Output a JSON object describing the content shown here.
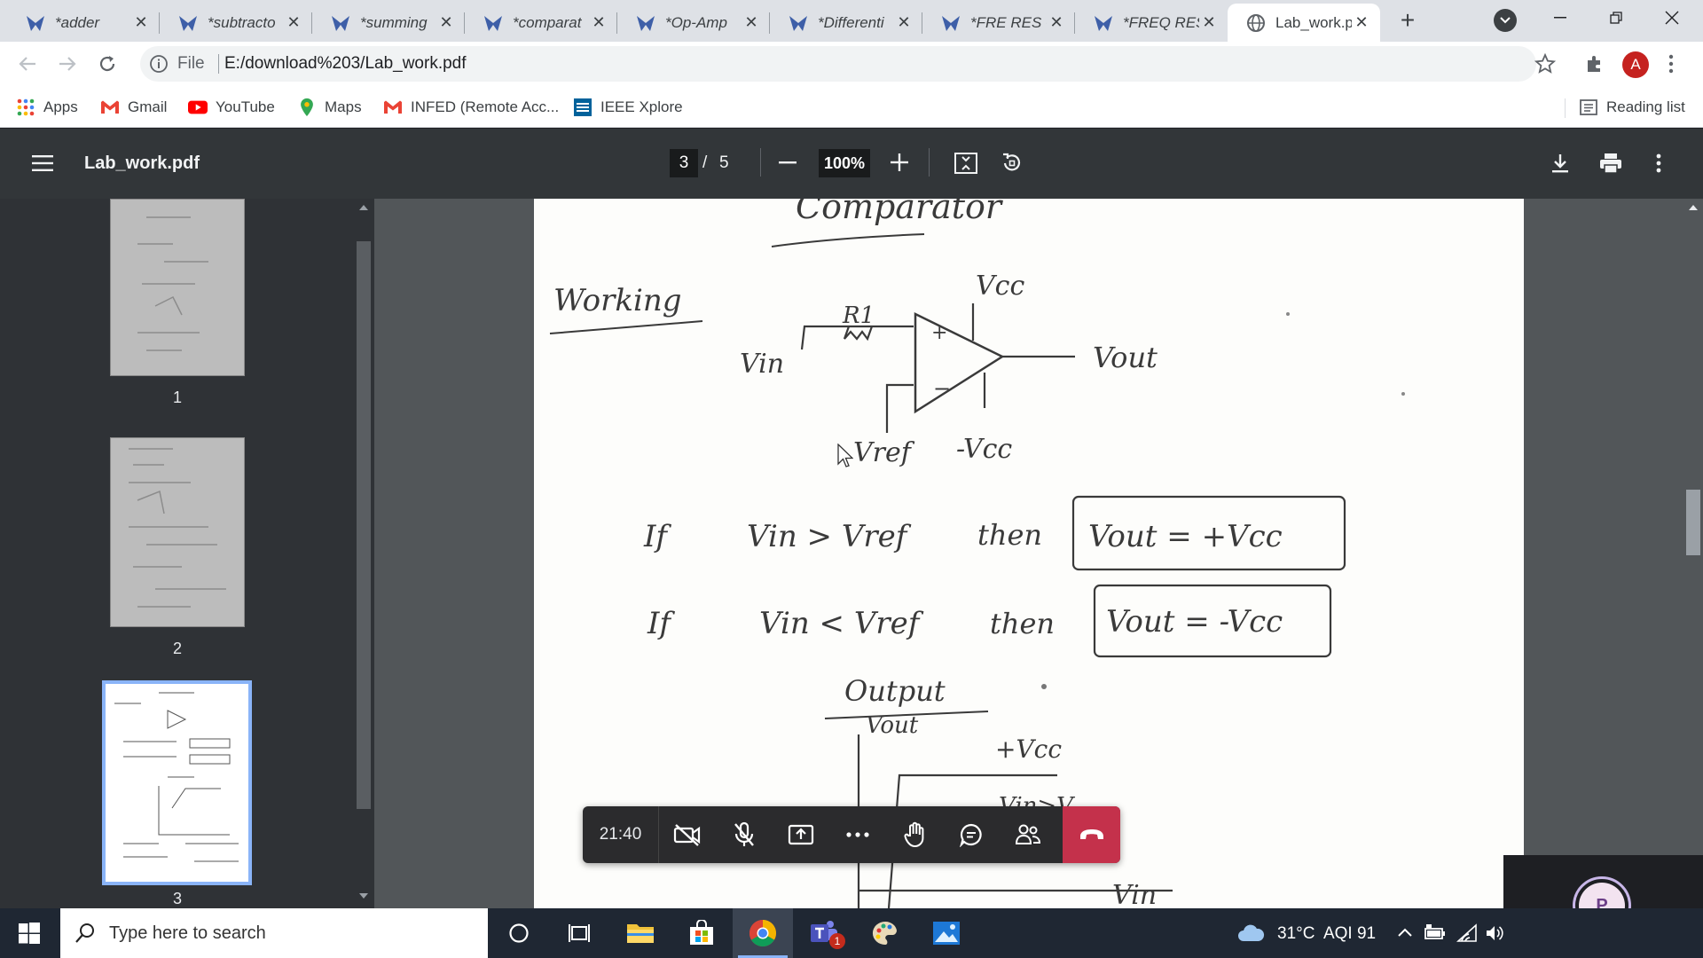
{
  "browser": {
    "tabs": [
      {
        "label": "*adder"
      },
      {
        "label": "*subtracto"
      },
      {
        "label": "*summing"
      },
      {
        "label": "*comparat"
      },
      {
        "label": "*Op-Amp"
      },
      {
        "label": "*Differenti"
      },
      {
        "label": "*FRE RES C"
      },
      {
        "label": "*FREQ RES"
      },
      {
        "label": "Lab_work.p"
      }
    ],
    "address": {
      "scheme": "File",
      "url": "E:/download%203/Lab_work.pdf"
    },
    "profile_initial": "A",
    "bookmarks": [
      {
        "label": "Apps"
      },
      {
        "label": "Gmail"
      },
      {
        "label": "YouTube"
      },
      {
        "label": "Maps"
      },
      {
        "label": "INFED (Remote Acc..."
      },
      {
        "label": "IEEE Xplore"
      }
    ],
    "reading_list": "Reading list"
  },
  "pdf": {
    "title": "Lab_work.pdf",
    "current_page": "3",
    "separator": "/",
    "total_pages": "5",
    "zoom": "100%",
    "thumbnails": [
      {
        "num": "1"
      },
      {
        "num": "2"
      },
      {
        "num": "3"
      }
    ],
    "content": {
      "heading": "Comparator",
      "working": "Working",
      "vcc": "Vcc",
      "r1": "R1",
      "vin": "Vin",
      "vout": "Vout",
      "vref": "Vref",
      "neg_vcc": "-Vcc",
      "if1": "If",
      "cond1": "Vin > Vref",
      "then1": "then",
      "result1": "Vout = +Vcc",
      "if2": "If",
      "cond2": "Vin < Vref",
      "then2": "then",
      "result2": "Vout = -Vcc",
      "output": "Output",
      "graph_vout": "Vout",
      "graph_pos_vcc": "+Vcc",
      "graph_vin": "Vin",
      "graph_vin_peek": "Vin>V"
    }
  },
  "call": {
    "timer": "21:40",
    "avatar_initial": "P",
    "colors": {
      "hangup": "#c4314b",
      "avatar_ring": "#c8b6e8",
      "avatar_bg": "#f3e3f0"
    }
  },
  "taskbar": {
    "search_placeholder": "Type here to search",
    "weather": "31°C  AQI 91",
    "teams_badge": "1"
  }
}
